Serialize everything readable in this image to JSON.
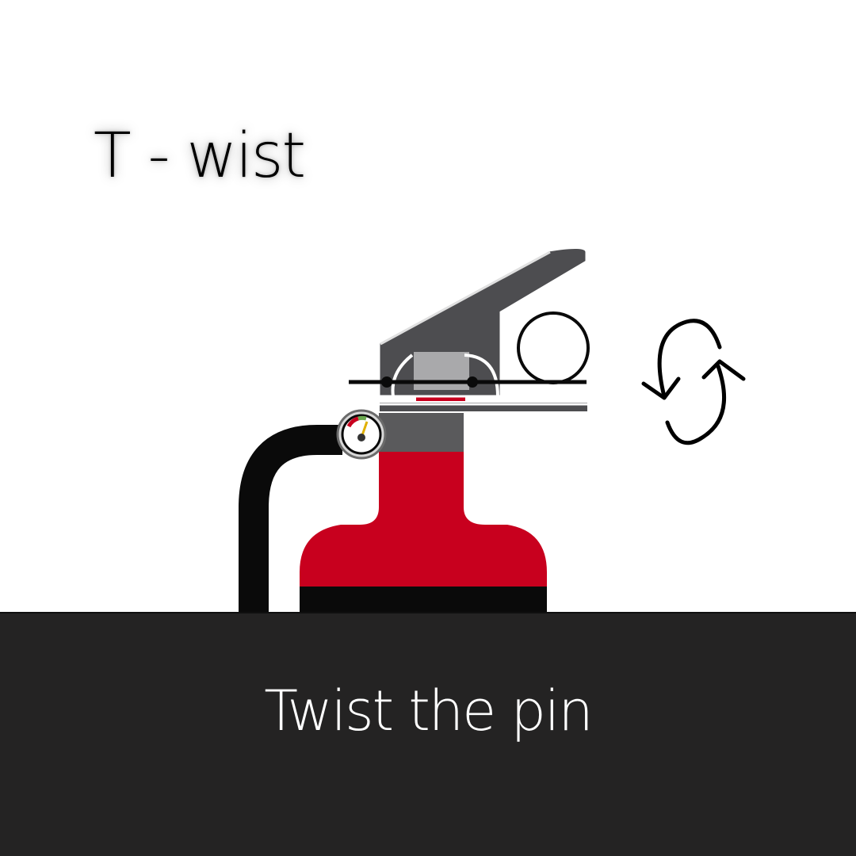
{
  "heading": "T - wist",
  "caption": "Twist the pin",
  "icons": {
    "extinguisher": "fire-extinguisher-icon",
    "rotate": "rotate-arrows-icon"
  },
  "colors": {
    "background": "#ffffff",
    "caption_bar": "#242323",
    "extinguisher_red": "#c8001e",
    "handle_gray": "#4d4d50",
    "neck_gray": "#5a5a5c",
    "hose_black": "#0a0a0a",
    "text_dark": "#000000",
    "text_light": "#ffffff"
  }
}
